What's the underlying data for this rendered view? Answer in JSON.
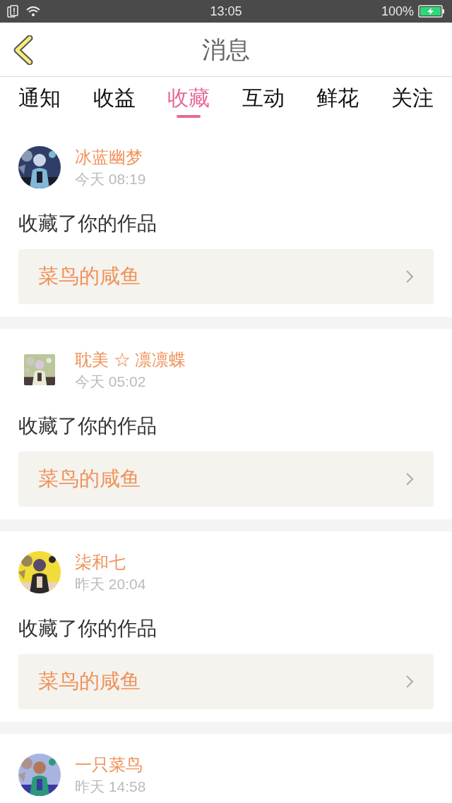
{
  "status_bar": {
    "time": "13:05",
    "battery": "100%",
    "charging": true
  },
  "header": {
    "title": "消息"
  },
  "tabs": [
    {
      "label": "通知",
      "selected": false
    },
    {
      "label": "收益",
      "selected": false
    },
    {
      "label": "收藏",
      "selected": true
    },
    {
      "label": "互动",
      "selected": false
    },
    {
      "label": "鲜花",
      "selected": false
    },
    {
      "label": "关注",
      "selected": false
    }
  ],
  "messages": [
    {
      "kind": "round",
      "user": "冰蓝幽梦",
      "time": "今天 08:19",
      "action": "收藏了你的作品",
      "work": "菜鸟的咸鱼"
    },
    {
      "kind": "square",
      "user": "耽美 ☆ 凛凛蝶",
      "time": "今天 05:02",
      "action": "收藏了你的作品",
      "work": "菜鸟的咸鱼"
    },
    {
      "kind": "round",
      "user": "柒和七",
      "time": "昨天 20:04",
      "action": "收藏了你的作品",
      "work": "菜鸟的咸鱼"
    },
    {
      "kind": "round",
      "user": "一只菜鸟",
      "time": "昨天 14:58"
    }
  ]
}
